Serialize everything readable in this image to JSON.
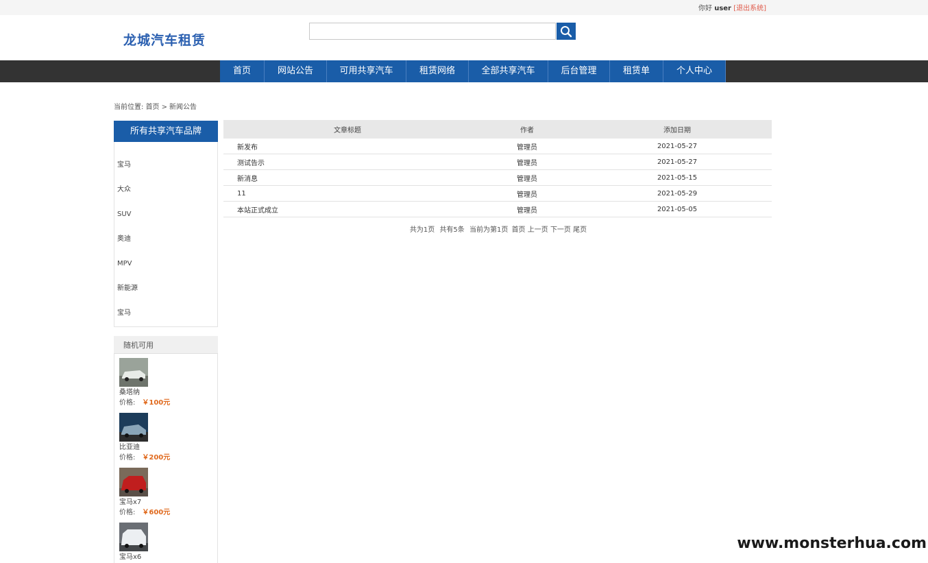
{
  "topbar": {
    "greeting": "你好",
    "username": "user",
    "logout": "[退出系统]"
  },
  "header": {
    "logo": "龙城汽车租赁",
    "search_placeholder": ""
  },
  "nav": [
    {
      "label": "首页"
    },
    {
      "label": "网站公告"
    },
    {
      "label": "可用共享汽车"
    },
    {
      "label": "租赁网络"
    },
    {
      "label": "全部共享汽车"
    },
    {
      "label": "后台管理"
    },
    {
      "label": "租赁单"
    },
    {
      "label": "个人中心"
    }
  ],
  "breadcrumb": {
    "prefix": "当前位置:",
    "home": "首页",
    "separator": ">",
    "current": "新闻公告"
  },
  "brands": {
    "title": "所有共享汽车品牌",
    "items": [
      "宝马",
      "大众",
      "SUV",
      "奥迪",
      "MPV",
      "新能源",
      "宝马"
    ]
  },
  "random": {
    "title": "随机可用",
    "price_label": "价格:",
    "cars": [
      {
        "name": "桑塔纳",
        "price": "￥100元"
      },
      {
        "name": "比亚迪",
        "price": "￥200元"
      },
      {
        "name": "宝马x7",
        "price": "￥600元"
      },
      {
        "name": "宝马x6",
        "price": ""
      }
    ]
  },
  "table": {
    "headers": [
      "文章标题",
      "作者",
      "添加日期"
    ],
    "rows": [
      {
        "title": "新发布",
        "author": "管理员",
        "date": "2021-05-27"
      },
      {
        "title": "测试告示",
        "author": "管理员",
        "date": "2021-05-27"
      },
      {
        "title": "新消息",
        "author": "管理员",
        "date": "2021-05-15"
      },
      {
        "title": "11",
        "author": "管理员",
        "date": "2021-05-29"
      },
      {
        "title": "本站正式成立",
        "author": "管理员",
        "date": "2021-05-05"
      }
    ]
  },
  "pager": {
    "total_pages": "共为1页",
    "total_items": "共有5条",
    "current_page": "当前为第1页",
    "first": "首页",
    "prev": "上一页",
    "next": "下一页",
    "last": "尾页"
  },
  "watermark": "www.monsterhua.com",
  "colors": {
    "primary": "#1a5da8",
    "navbar_bg": "#333333",
    "price": "#e06a1e",
    "logout": "#e05a4a"
  }
}
